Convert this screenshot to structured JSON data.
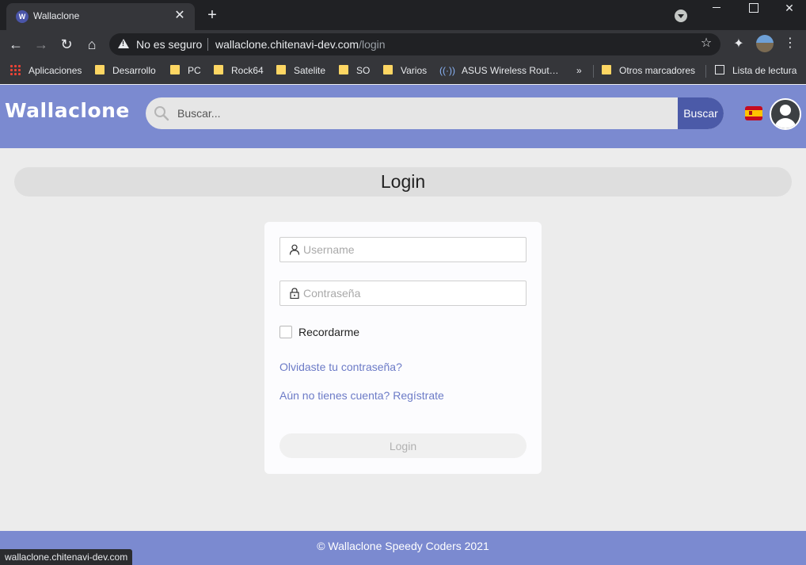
{
  "browser": {
    "tab_title": "Wallaclone",
    "tab_favicon": "W",
    "tab_close": "✕",
    "new_tab": "+",
    "security_label": "No es seguro",
    "url_host": "wallaclone.chitenavi-dev.com",
    "url_path": "/login",
    "status_url": "wallaclone.chitenavi-dev.com"
  },
  "bookmarks": {
    "items": [
      "Aplicaciones",
      "Desarrollo",
      "PC",
      "Rock64",
      "Satelite",
      "SO",
      "Varios",
      "ASUS Wireless Rout…"
    ],
    "overflow": "»",
    "other": "Otros marcadores",
    "reading_list": "Lista de lectura"
  },
  "header": {
    "logo": "Wallaclone",
    "search_placeholder": "Buscar...",
    "search_button": "Buscar"
  },
  "main": {
    "title": "Login",
    "username_placeholder": "Username",
    "password_placeholder": "Contraseña",
    "remember_label": "Recordarme",
    "forgot_link": "Olvidaste tu contraseña?",
    "register_link": "Aún no tienes cuenta? Regístrate",
    "login_button": "Login"
  },
  "footer": {
    "text": "© Wallaclone Speedy Coders 2021"
  },
  "colors": {
    "header_bg": "#7b8ad0",
    "search_button_bg": "#4b5aa8",
    "link": "#6c7bc7",
    "page_bg": "#ececec"
  },
  "icons": [
    "warning-icon",
    "star-icon",
    "extensions-icon",
    "profile-icon",
    "menu-icon",
    "search-icon",
    "spain-flag-icon",
    "user-avatar-icon",
    "user-icon",
    "lock-icon"
  ]
}
